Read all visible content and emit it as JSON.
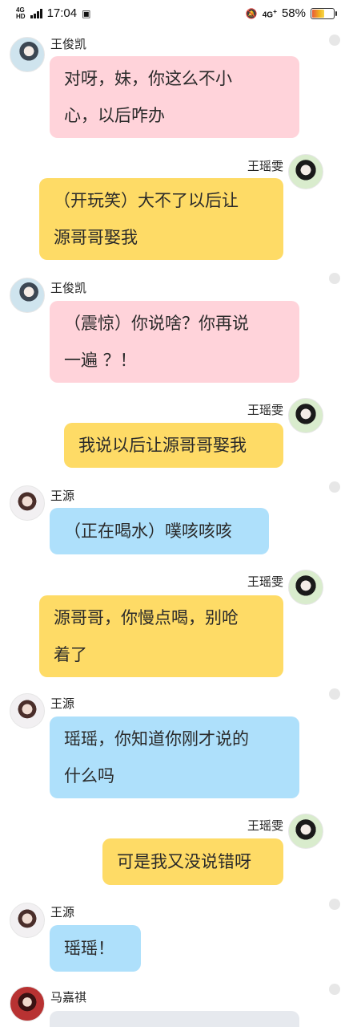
{
  "status_bar": {
    "network_left": "4G",
    "network_left_sub": "HD",
    "time": "17:04",
    "network_right": "4G",
    "network_right_sup": "+",
    "battery_percent": "58%",
    "battery_level": 0.58,
    "icons": [
      "signal-icon",
      "nfc-icon",
      "mute-icon",
      "battery-icon"
    ]
  },
  "messages": [
    {
      "sender": "王俊凯",
      "side": "left",
      "color": "pink",
      "lines": [
        "对呀，妹，你这么不小",
        "心，以后咋办"
      ]
    },
    {
      "sender": "王瑶雯",
      "side": "right",
      "color": "yellow",
      "lines": [
        "（开玩笑）大不了以后让",
        "源哥哥娶我"
      ]
    },
    {
      "sender": "王俊凯",
      "side": "left",
      "color": "pink",
      "lines": [
        "（震惊）你说啥？你再说",
        "一遍 ？！"
      ]
    },
    {
      "sender": "王瑶雯",
      "side": "right",
      "color": "yellow",
      "lines": [
        "我说以后让源哥哥娶我"
      ]
    },
    {
      "sender": "王源",
      "side": "left",
      "color": "blue",
      "lines": [
        "（正在喝水）噗咳咳咳"
      ]
    },
    {
      "sender": "王瑶雯",
      "side": "right",
      "color": "yellow",
      "lines": [
        "源哥哥，你慢点喝，别呛",
        "着了"
      ]
    },
    {
      "sender": "王源",
      "side": "left",
      "color": "blue",
      "lines": [
        "瑶瑶，你知道你刚才说的",
        "什么吗"
      ]
    },
    {
      "sender": "王瑶雯",
      "side": "right",
      "color": "yellow",
      "lines": [
        "可是我又没说错呀"
      ]
    },
    {
      "sender": "王源",
      "side": "left",
      "color": "blue",
      "lines": [
        "瑶瑶！"
      ]
    },
    {
      "sender": "马嘉祺",
      "side": "left",
      "color": "gray",
      "lines": [
        ""
      ]
    }
  ]
}
